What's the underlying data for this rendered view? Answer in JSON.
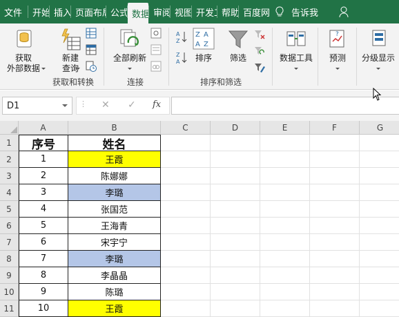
{
  "tabs": [
    "文件",
    "开始",
    "插入",
    "页面布局",
    "公式",
    "数据",
    "审阅",
    "视图",
    "开发工具",
    "帮助",
    "百度网盘"
  ],
  "active_tab": "数据",
  "tell_me": "告诉我",
  "ribbon": {
    "get_external": [
      "获取",
      "外部数据"
    ],
    "new_query": [
      "新建",
      "查询"
    ],
    "group_get_transform": "获取和转换",
    "refresh_all": "全部刷新",
    "group_connections": "连接",
    "sort": "排序",
    "filter": "筛选",
    "group_sort_filter": "排序和筛选",
    "data_tools": "数据工具",
    "forecast": "预测",
    "outline": "分级显示"
  },
  "formula_bar": {
    "name_box": "D1",
    "fx": "fx",
    "formula": ""
  },
  "columns": [
    "A",
    "B",
    "C",
    "D",
    "E",
    "F",
    "G"
  ],
  "rows": [
    "1",
    "2",
    "3",
    "4",
    "5",
    "6",
    "7",
    "8",
    "9",
    "10",
    "11"
  ],
  "sheet": {
    "headers": [
      "序号",
      "姓名"
    ],
    "data": [
      {
        "no": "1",
        "name": "王霞",
        "fill": "#ffff00"
      },
      {
        "no": "2",
        "name": "陈娜娜",
        "fill": "#ffffff"
      },
      {
        "no": "3",
        "name": "李璐",
        "fill": "#b4c6e7"
      },
      {
        "no": "4",
        "name": "张国范",
        "fill": "#ffffff"
      },
      {
        "no": "5",
        "name": "王海青",
        "fill": "#ffffff"
      },
      {
        "no": "6",
        "name": "宋宇宁",
        "fill": "#ffffff"
      },
      {
        "no": "7",
        "name": "李璐",
        "fill": "#b4c6e7"
      },
      {
        "no": "8",
        "name": "李晶晶",
        "fill": "#ffffff"
      },
      {
        "no": "9",
        "name": "陈璐",
        "fill": "#ffffff"
      },
      {
        "no": "10",
        "name": "王霞",
        "fill": "#ffff00"
      }
    ]
  },
  "colors": {
    "brand": "#217346",
    "yellow": "#ffff00",
    "blue": "#b4c6e7"
  }
}
